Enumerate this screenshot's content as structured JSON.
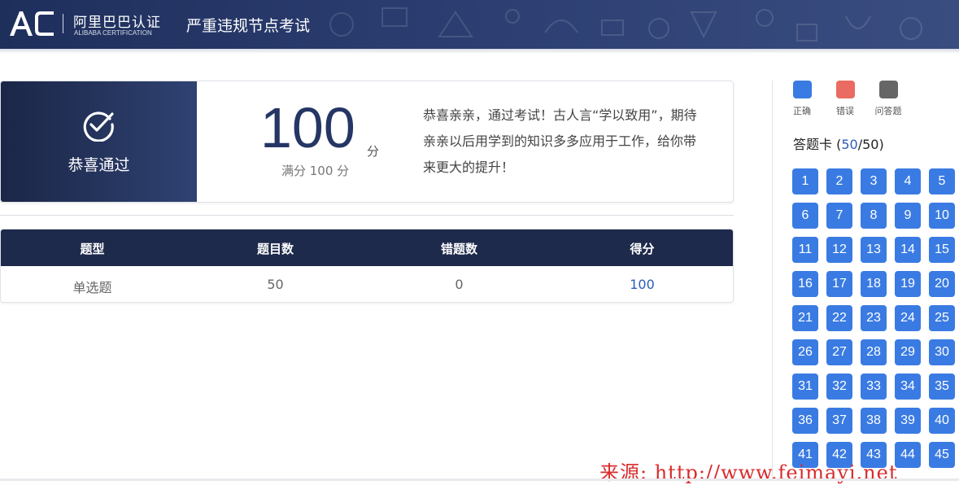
{
  "header": {
    "logo_text": "AC",
    "logo_cn": "阿里巴巴认证",
    "logo_en": "ALIBABA CERTIFICATION",
    "exam_title": "严重违规节点考试",
    "bg_color": "#24355f"
  },
  "result": {
    "pass_label": "恭喜通过",
    "score": "100",
    "score_unit": "分",
    "full_score": "满分 100 分",
    "message": "恭喜亲亲，通过考试！古人言“学以致用”，期待亲亲以后用学到的知识多多应用于工作，给你带来更大的提升！",
    "icon": "check-circle-icon"
  },
  "stats": {
    "headers": [
      "题型",
      "题目数",
      "错题数",
      "得分"
    ],
    "row": [
      "单选题",
      "50",
      "0",
      "100"
    ]
  },
  "legend": [
    {
      "label": "正确",
      "color": "#3a7be3"
    },
    {
      "label": "错误",
      "color": "#ea6b61"
    },
    {
      "label": "问答题",
      "color": "#666666"
    }
  ],
  "answer_card": {
    "title": "答题卡",
    "answered": "50",
    "total": "50",
    "questions": [
      "1",
      "2",
      "3",
      "4",
      "5",
      "6",
      "7",
      "8",
      "9",
      "10",
      "11",
      "12",
      "13",
      "14",
      "15",
      "16",
      "17",
      "18",
      "19",
      "20",
      "21",
      "22",
      "23",
      "24",
      "25",
      "26",
      "27",
      "28",
      "29",
      "30",
      "31",
      "32",
      "33",
      "34",
      "35",
      "36",
      "37",
      "38",
      "39",
      "40",
      "41",
      "42",
      "43",
      "44",
      "45"
    ]
  },
  "watermark": "来源: http://www.feimayi.net"
}
